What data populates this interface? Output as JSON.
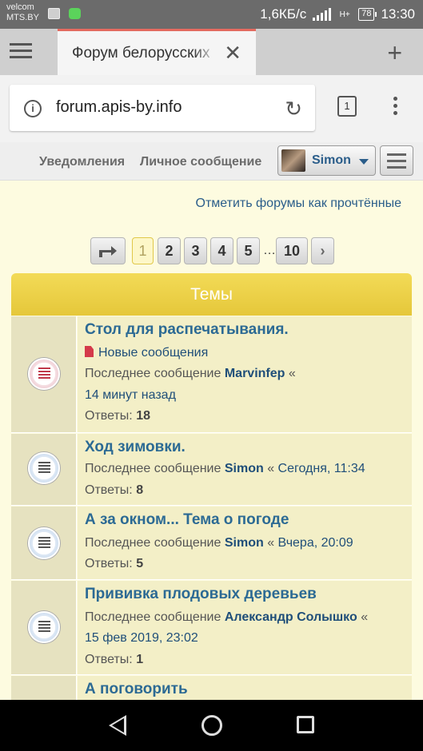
{
  "status_bar": {
    "carrier1": "velcom",
    "carrier2": "MTS.BY",
    "speed": "1,6КБ/с",
    "network": "H+",
    "battery": "78",
    "time": "13:30"
  },
  "browser": {
    "tab_title": "Форум белорусских",
    "url": "forum.apis-by.info",
    "tabs_count": "1"
  },
  "forum_nav": {
    "notifications": "Уведомления",
    "private_message": "Личное сообщение",
    "user": "Simon"
  },
  "mark_read": "Отметить форумы как прочтённые",
  "pagination": {
    "pages": [
      "1",
      "2",
      "3",
      "4",
      "5"
    ],
    "ellipsis": "…",
    "last": "10",
    "next": "›"
  },
  "topics_header": "Темы",
  "topics": [
    {
      "title": "Стол для распечатывания.",
      "new_posts": "Новые сообщения",
      "last_label": "Последнее сообщение",
      "author": "Marvinfep",
      "sep": "«",
      "time": "14 минут назад",
      "replies_label": "Ответы:",
      "replies": "18",
      "unread": true
    },
    {
      "title": "Ход зимовки.",
      "last_label": "Последнее сообщение",
      "author": "Simon",
      "sep": "«",
      "time": "Сегодня, 11:34",
      "replies_label": "Ответы:",
      "replies": "8",
      "unread": false
    },
    {
      "title": "А за окном... Тема о погоде",
      "last_label": "Последнее сообщение",
      "author": "Simon",
      "sep": "«",
      "time": "Вчера, 20:09",
      "replies_label": "Ответы:",
      "replies": "5",
      "unread": false
    },
    {
      "title": "Прививка плодовых деревьев",
      "last_label": "Последнее сообщение",
      "author": "Александр Солышко",
      "sep": "«",
      "time": "15 фев 2019, 23:02",
      "replies_label": "Ответы:",
      "replies": "1",
      "unread": false
    },
    {
      "title": "А поговорить"
    }
  ]
}
